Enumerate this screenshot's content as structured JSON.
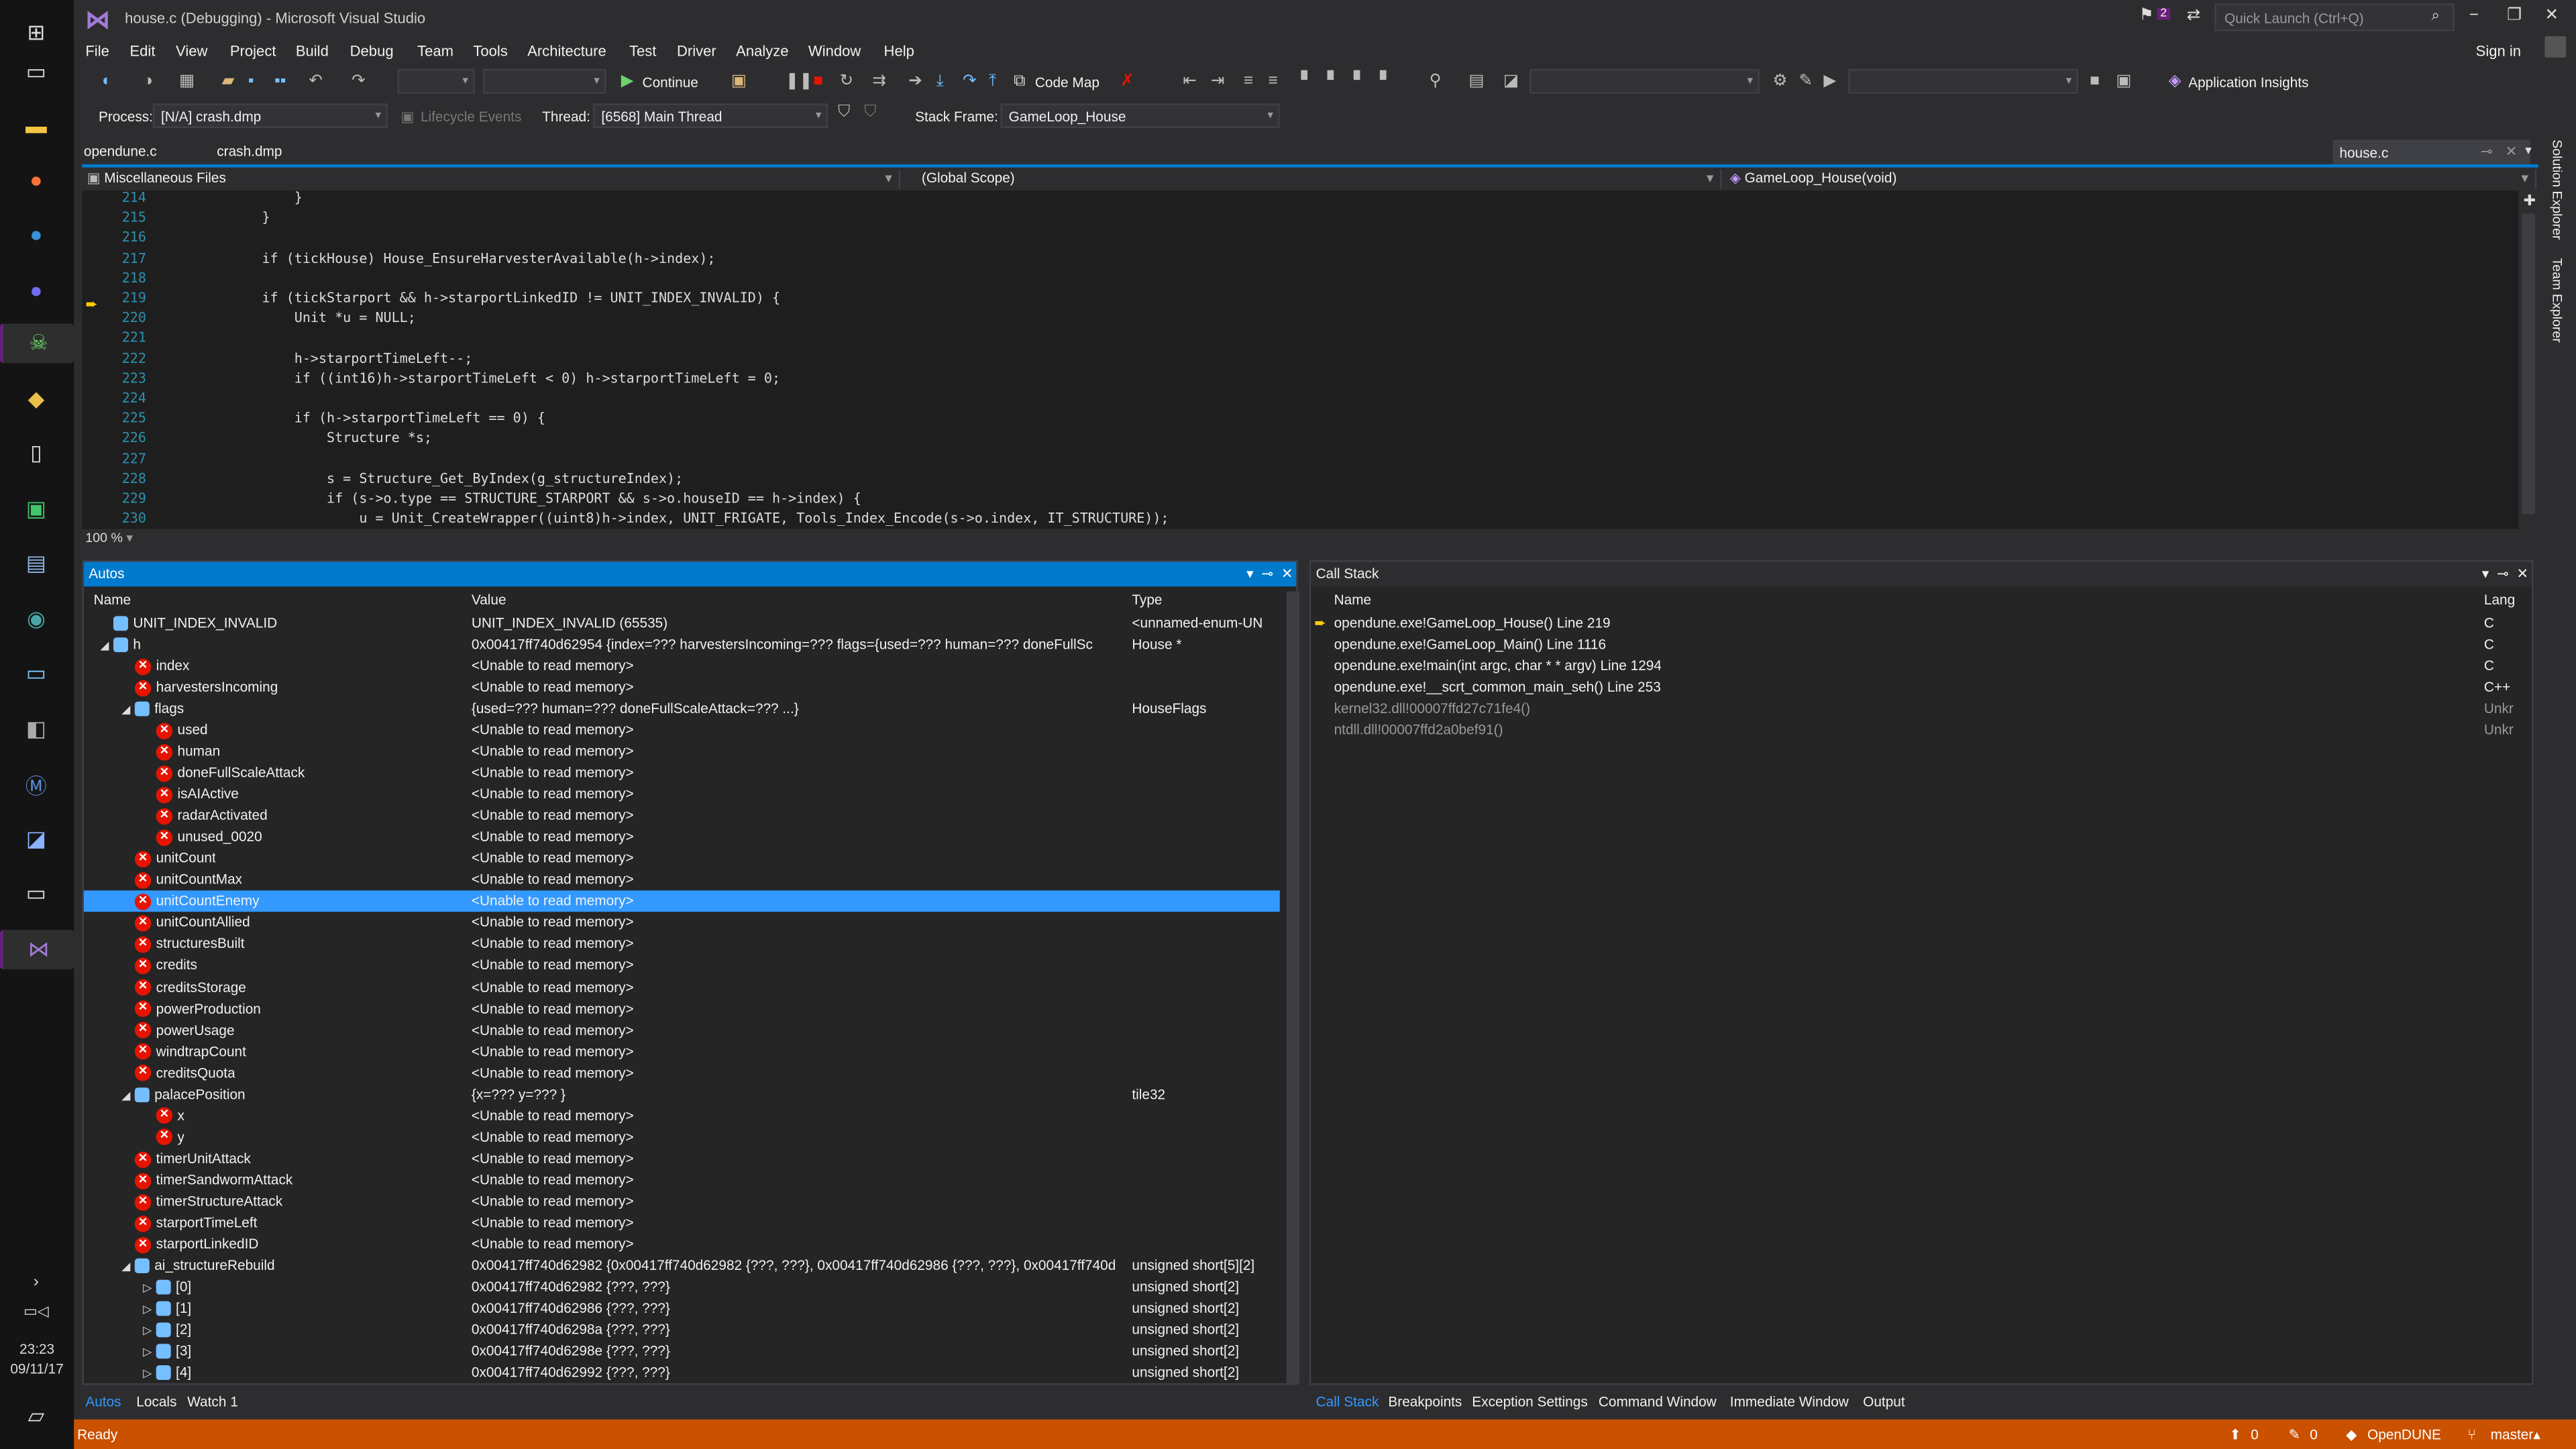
{
  "window": {
    "title": "house.c (Debugging) - Microsoft Visual Studio",
    "quick_launch_placeholder": "Quick Launch (Ctrl+Q)",
    "sign_in": "Sign in",
    "notifications": "2"
  },
  "taskbar": {
    "time": "23:23",
    "date": "09/11/17"
  },
  "menu": [
    "File",
    "Edit",
    "View",
    "Project",
    "Build",
    "Debug",
    "Team",
    "Tools",
    "Architecture",
    "Test",
    "Driver",
    "Analyze",
    "Window",
    "Help"
  ],
  "toolbar": {
    "continue_label": "Continue",
    "code_map_label": "Code Map",
    "app_insights_label": "Application Insights",
    "process_label": "Process:",
    "process_value": "[N/A] crash.dmp",
    "lifecycle_label": "Lifecycle Events",
    "thread_label": "Thread:",
    "thread_value": "[6568] Main Thread",
    "stack_frame_label": "Stack Frame:",
    "stack_frame_value": "GameLoop_House"
  },
  "doc_tabs": {
    "tab1": "opendune.c",
    "tab2": "crash.dmp",
    "active": "house.c"
  },
  "nav": {
    "project": "Miscellaneous Files",
    "scope": "(Global Scope)",
    "function": "GameLoop_House(void)"
  },
  "editor": {
    "zoom": "100 %",
    "lines": [
      {
        "n": "214",
        "text": "            }"
      },
      {
        "n": "215",
        "text": "        }"
      },
      {
        "n": "216",
        "text": ""
      },
      {
        "n": "217",
        "text": "        if (tickHouse) House_EnsureHarvesterAvailable(h->index);"
      },
      {
        "n": "218",
        "text": ""
      },
      {
        "n": "219",
        "text": "        if (tickStarport && h->starportLinkedID != UNIT_INDEX_INVALID) {"
      },
      {
        "n": "220",
        "text": "            Unit *u = NULL;"
      },
      {
        "n": "221",
        "text": ""
      },
      {
        "n": "222",
        "text": "            h->starportTimeLeft--;"
      },
      {
        "n": "223",
        "text": "            if ((int16)h->starportTimeLeft < 0) h->starportTimeLeft = 0;"
      },
      {
        "n": "224",
        "text": ""
      },
      {
        "n": "225",
        "text": "            if (h->starportTimeLeft == 0) {"
      },
      {
        "n": "226",
        "text": "                Structure *s;"
      },
      {
        "n": "227",
        "text": ""
      },
      {
        "n": "228",
        "text": "                s = Structure_Get_ByIndex(g_structureIndex);"
      },
      {
        "n": "229",
        "text": "                if (s->o.type == STRUCTURE_STARPORT && s->o.houseID == h->index) {"
      },
      {
        "n": "230",
        "text": "                    u = Unit_CreateWrapper((uint8)h->index, UNIT_FRIGATE, Tools_Index_Encode(s->o.index, IT_STRUCTURE));"
      }
    ]
  },
  "autos": {
    "title": "Autos",
    "col_name": "Name",
    "col_value": "Value",
    "col_type": "Type",
    "rows": [
      {
        "indent": 0,
        "exp": "",
        "icon": "obj",
        "name": "UNIT_INDEX_INVALID",
        "value": "UNIT_INDEX_INVALID (65535)",
        "type": "<unnamed-enum-UN"
      },
      {
        "indent": 0,
        "exp": "◢",
        "icon": "obj",
        "name": "h",
        "value": "0x00417ff740d62954 {index=??? harvestersIncoming=??? flags={used=??? human=??? doneFullSc",
        "type": "House *"
      },
      {
        "indent": 1,
        "exp": "",
        "icon": "err",
        "name": "index",
        "value": "<Unable to read memory>",
        "type": ""
      },
      {
        "indent": 1,
        "exp": "",
        "icon": "err",
        "name": "harvestersIncoming",
        "value": "<Unable to read memory>",
        "type": ""
      },
      {
        "indent": 1,
        "exp": "◢",
        "icon": "obj",
        "name": "flags",
        "value": "{used=??? human=??? doneFullScaleAttack=??? ...}",
        "type": "HouseFlags"
      },
      {
        "indent": 2,
        "exp": "",
        "icon": "err",
        "name": "used",
        "value": "<Unable to read memory>",
        "type": ""
      },
      {
        "indent": 2,
        "exp": "",
        "icon": "err",
        "name": "human",
        "value": "<Unable to read memory>",
        "type": ""
      },
      {
        "indent": 2,
        "exp": "",
        "icon": "err",
        "name": "doneFullScaleAttack",
        "value": "<Unable to read memory>",
        "type": ""
      },
      {
        "indent": 2,
        "exp": "",
        "icon": "err",
        "name": "isAIActive",
        "value": "<Unable to read memory>",
        "type": ""
      },
      {
        "indent": 2,
        "exp": "",
        "icon": "err",
        "name": "radarActivated",
        "value": "<Unable to read memory>",
        "type": ""
      },
      {
        "indent": 2,
        "exp": "",
        "icon": "err",
        "name": "unused_0020",
        "value": "<Unable to read memory>",
        "type": ""
      },
      {
        "indent": 1,
        "exp": "",
        "icon": "err",
        "name": "unitCount",
        "value": "<Unable to read memory>",
        "type": ""
      },
      {
        "indent": 1,
        "exp": "",
        "icon": "err",
        "name": "unitCountMax",
        "value": "<Unable to read memory>",
        "type": ""
      },
      {
        "indent": 1,
        "exp": "",
        "icon": "err",
        "name": "unitCountEnemy",
        "value": "<Unable to read memory>",
        "type": "",
        "selected": true
      },
      {
        "indent": 1,
        "exp": "",
        "icon": "err",
        "name": "unitCountAllied",
        "value": "<Unable to read memory>",
        "type": ""
      },
      {
        "indent": 1,
        "exp": "",
        "icon": "err",
        "name": "structuresBuilt",
        "value": "<Unable to read memory>",
        "type": ""
      },
      {
        "indent": 1,
        "exp": "",
        "icon": "err",
        "name": "credits",
        "value": "<Unable to read memory>",
        "type": ""
      },
      {
        "indent": 1,
        "exp": "",
        "icon": "err",
        "name": "creditsStorage",
        "value": "<Unable to read memory>",
        "type": ""
      },
      {
        "indent": 1,
        "exp": "",
        "icon": "err",
        "name": "powerProduction",
        "value": "<Unable to read memory>",
        "type": ""
      },
      {
        "indent": 1,
        "exp": "",
        "icon": "err",
        "name": "powerUsage",
        "value": "<Unable to read memory>",
        "type": ""
      },
      {
        "indent": 1,
        "exp": "",
        "icon": "err",
        "name": "windtrapCount",
        "value": "<Unable to read memory>",
        "type": ""
      },
      {
        "indent": 1,
        "exp": "",
        "icon": "err",
        "name": "creditsQuota",
        "value": "<Unable to read memory>",
        "type": ""
      },
      {
        "indent": 1,
        "exp": "◢",
        "icon": "obj",
        "name": "palacePosition",
        "value": "{x=??? y=??? }",
        "type": "tile32"
      },
      {
        "indent": 2,
        "exp": "",
        "icon": "err",
        "name": "x",
        "value": "<Unable to read memory>",
        "type": ""
      },
      {
        "indent": 2,
        "exp": "",
        "icon": "err",
        "name": "y",
        "value": "<Unable to read memory>",
        "type": ""
      },
      {
        "indent": 1,
        "exp": "",
        "icon": "err",
        "name": "timerUnitAttack",
        "value": "<Unable to read memory>",
        "type": ""
      },
      {
        "indent": 1,
        "exp": "",
        "icon": "err",
        "name": "timerSandwormAttack",
        "value": "<Unable to read memory>",
        "type": ""
      },
      {
        "indent": 1,
        "exp": "",
        "icon": "err",
        "name": "timerStructureAttack",
        "value": "<Unable to read memory>",
        "type": ""
      },
      {
        "indent": 1,
        "exp": "",
        "icon": "err",
        "name": "starportTimeLeft",
        "value": "<Unable to read memory>",
        "type": ""
      },
      {
        "indent": 1,
        "exp": "",
        "icon": "err",
        "name": "starportLinkedID",
        "value": "<Unable to read memory>",
        "type": ""
      },
      {
        "indent": 1,
        "exp": "◢",
        "icon": "obj",
        "name": "ai_structureRebuild",
        "value": "0x00417ff740d62982 {0x00417ff740d62982 {???, ???}, 0x00417ff740d62986 {???, ???}, 0x00417ff740d",
        "type": "unsigned short[5][2]"
      },
      {
        "indent": 2,
        "exp": "▷",
        "icon": "obj",
        "name": "[0]",
        "value": "0x00417ff740d62982 {???, ???}",
        "type": "unsigned short[2]"
      },
      {
        "indent": 2,
        "exp": "▷",
        "icon": "obj",
        "name": "[1]",
        "value": "0x00417ff740d62986 {???, ???}",
        "type": "unsigned short[2]"
      },
      {
        "indent": 2,
        "exp": "▷",
        "icon": "obj",
        "name": "[2]",
        "value": "0x00417ff740d6298a {???, ???}",
        "type": "unsigned short[2]"
      },
      {
        "indent": 2,
        "exp": "▷",
        "icon": "obj",
        "name": "[3]",
        "value": "0x00417ff740d6298e {???, ???}",
        "type": "unsigned short[2]"
      },
      {
        "indent": 2,
        "exp": "▷",
        "icon": "obj",
        "name": "[4]",
        "value": "0x00417ff740d62992 {???, ???}",
        "type": "unsigned short[2]"
      }
    ]
  },
  "callstack": {
    "title": "Call Stack",
    "col_name": "Name",
    "col_lang": "Lang",
    "rows": [
      {
        "name": "opendune.exe!GameLoop_House() Line 219",
        "lang": "C",
        "current": true,
        "dim": false
      },
      {
        "name": "opendune.exe!GameLoop_Main() Line 1116",
        "lang": "C",
        "current": false,
        "dim": false
      },
      {
        "name": "opendune.exe!main(int argc, char * * argv) Line 1294",
        "lang": "C",
        "current": false,
        "dim": false
      },
      {
        "name": "opendune.exe!__scrt_common_main_seh() Line 253",
        "lang": "C++",
        "current": false,
        "dim": false
      },
      {
        "name": "kernel32.dll!00007ffd27c71fe4()",
        "lang": "Unkr",
        "current": false,
        "dim": true
      },
      {
        "name": "ntdll.dll!00007ffd2a0bef91()",
        "lang": "Unkr",
        "current": false,
        "dim": true
      }
    ]
  },
  "bottom_tabs_left": [
    "Autos",
    "Locals",
    "Watch 1"
  ],
  "bottom_tabs_right": [
    "Call Stack",
    "Breakpoints",
    "Exception Settings",
    "Command Window",
    "Immediate Window",
    "Output"
  ],
  "status": {
    "text": "Ready",
    "up_count": "0",
    "edit_count": "0",
    "repo": "OpenDUNE",
    "branch": "master"
  },
  "side_tabs": [
    "Solution Explorer",
    "Team Explorer"
  ]
}
